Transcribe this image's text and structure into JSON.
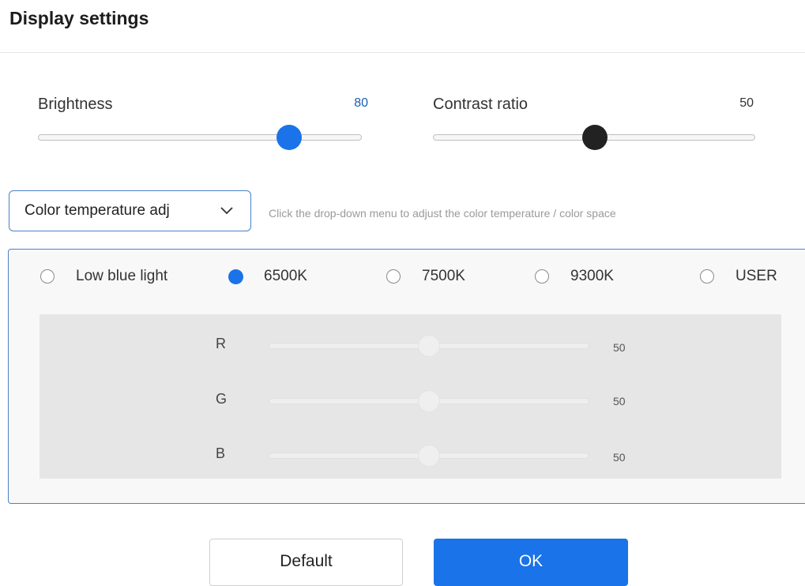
{
  "title": "Display settings",
  "brightness": {
    "label": "Brightness",
    "value": "80",
    "value_color": "#1a5fb4",
    "thumb_color": "#1a73e8"
  },
  "contrast": {
    "label": "Contrast ratio",
    "value": "50",
    "value_color": "#333333",
    "thumb_color": "#222222"
  },
  "dropdown": {
    "selected": "Color temperature adj",
    "icon": "chevron-down-icon",
    "hint": "Click the drop-down menu to adjust the color temperature / color space"
  },
  "presets": [
    {
      "label": "Low blue light",
      "selected": false
    },
    {
      "label": "6500K",
      "selected": true
    },
    {
      "label": "7500K",
      "selected": false
    },
    {
      "label": "9300K",
      "selected": false
    },
    {
      "label": "USER",
      "selected": false
    }
  ],
  "rgb": [
    {
      "label": "R",
      "value": "50"
    },
    {
      "label": "G",
      "value": "50"
    },
    {
      "label": "B",
      "value": "50"
    }
  ],
  "buttons": {
    "default": "Default",
    "ok": "OK"
  },
  "colors": {
    "accent": "#1a73e8",
    "panel_border": "#4a80c8"
  }
}
